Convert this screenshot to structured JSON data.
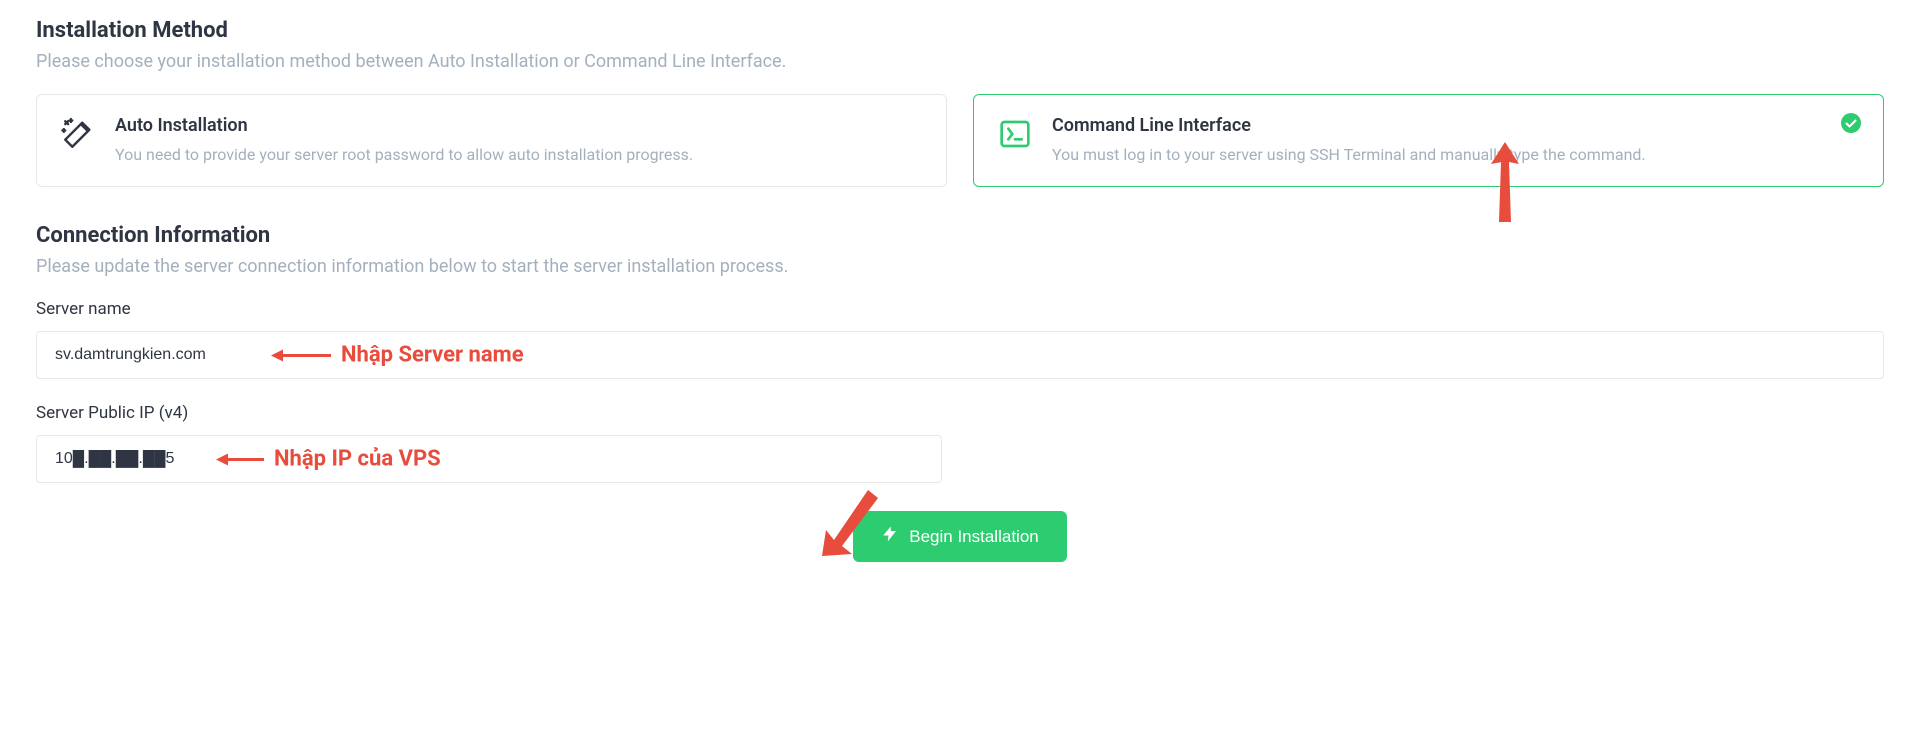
{
  "method_section": {
    "title": "Installation Method",
    "desc": "Please choose your installation method between Auto Installation or Command Line Interface."
  },
  "methods": {
    "auto": {
      "title": "Auto Installation",
      "desc": "You need to provide your server root password to allow auto installation progress."
    },
    "cli": {
      "title": "Command Line Interface",
      "desc": "You must log in to your server using SSH Terminal and manually type the command."
    }
  },
  "conn_section": {
    "title": "Connection Information",
    "desc": "Please update the server connection information below to start the server installation process."
  },
  "fields": {
    "server_name": {
      "label": "Server name",
      "value": "sv.damtrungkien.com"
    },
    "server_ip": {
      "label": "Server Public IP (v4)",
      "value": "10█.██.██.██5"
    }
  },
  "annotations": {
    "server_name_hint": "Nhập Server name",
    "server_ip_hint": "Nhập IP của VPS"
  },
  "submit": {
    "label": "Begin Installation"
  }
}
